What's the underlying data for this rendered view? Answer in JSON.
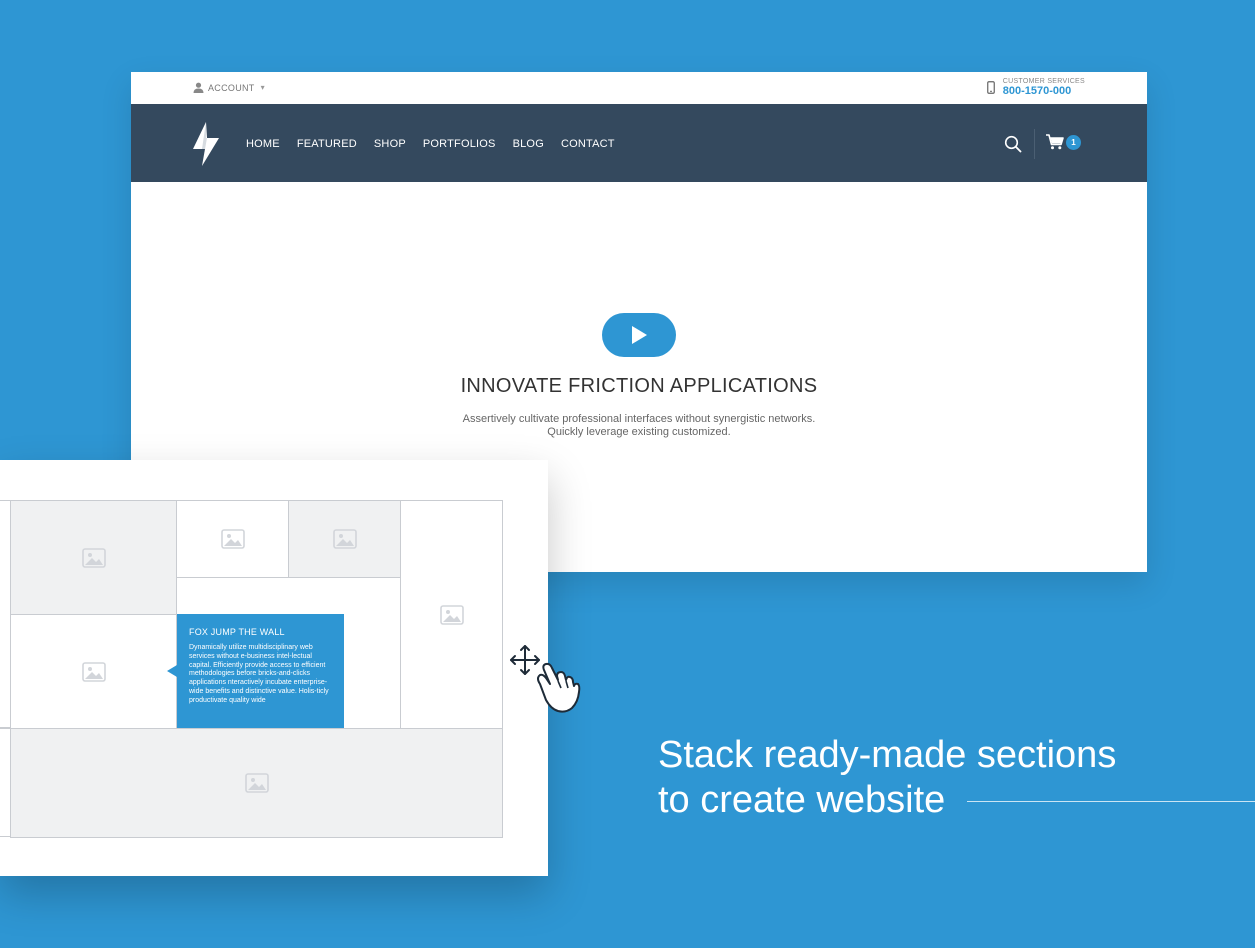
{
  "topbar": {
    "account_label": "ACCOUNT",
    "caret": "▾",
    "support_label": "CUSTOMER SERVICES",
    "support_phone": "800-1570-000"
  },
  "nav": {
    "items": [
      "HOME",
      "FEATURED",
      "SHOP",
      "PORTFOLIOS",
      "BLOG",
      "CONTACT"
    ],
    "cart_count": "1"
  },
  "hero": {
    "title": "INNOVATE FRICTION APPLICATIONS",
    "subtitle": "Assertively cultivate professional interfaces without synergistic networks. Quickly leverage existing customized."
  },
  "layout_card": {
    "callout_title": "FOX JUMP THE WALL",
    "callout_body": "Dynamically utilize multidisciplinary web services without e-business intel-lectual capital. Efficiently provide access to efficient methodologies before bricks-and-clicks applications nteractively incubate enterprise-wide benefits and distinctive value. Holis-ticly productivate quality wide"
  },
  "tagline": {
    "line1": "Stack ready-made sections",
    "line2": "to create website"
  },
  "colors": {
    "background": "#2e96d3",
    "navbar": "#34495e",
    "accent": "#2e96d3"
  },
  "icons": [
    "user-icon",
    "phone-icon",
    "logo-bolt-icon",
    "search-icon",
    "cart-icon",
    "play-icon",
    "image-placeholder-icon",
    "move-icon",
    "hand-pointer-icon"
  ]
}
